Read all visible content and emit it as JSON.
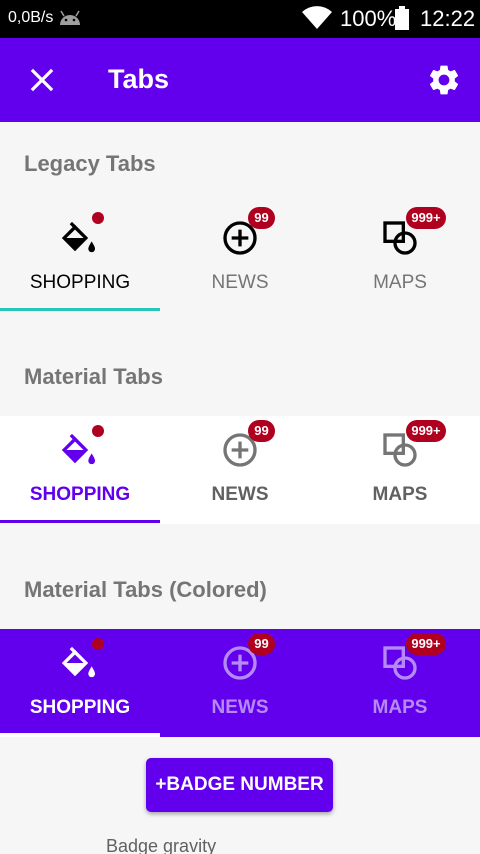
{
  "status_bar": {
    "net_speed": "0,0B/s",
    "battery": "100%",
    "time": "12:22",
    "icons": [
      "android-icon",
      "wifi-icon",
      "battery-icon"
    ]
  },
  "app_bar": {
    "title": "Tabs",
    "close_icon": "close-icon",
    "settings_icon": "settings-icon"
  },
  "sections": [
    {
      "title": "Legacy Tabs",
      "tabs": [
        "SHOPPING",
        "NEWS",
        "MAPS"
      ],
      "selected": "SHOPPING"
    },
    {
      "title": "Material Tabs",
      "tabs": [
        "SHOPPING",
        "NEWS",
        "MAPS"
      ],
      "selected": "SHOPPING"
    },
    {
      "title": "Material Tabs (Colored)",
      "tabs": [
        "SHOPPING",
        "NEWS",
        "MAPS"
      ],
      "selected": "SHOPPING"
    }
  ],
  "badges": {
    "news": "99",
    "maps": "999+"
  },
  "button": {
    "label": "+BADGE NUMBER"
  },
  "gravity": {
    "label": "Badge gravity"
  },
  "colors": {
    "primary": "#6200ee",
    "badge": "#b00020",
    "legacy_indicator": "#26c6bb",
    "status_bar": "#000000"
  }
}
